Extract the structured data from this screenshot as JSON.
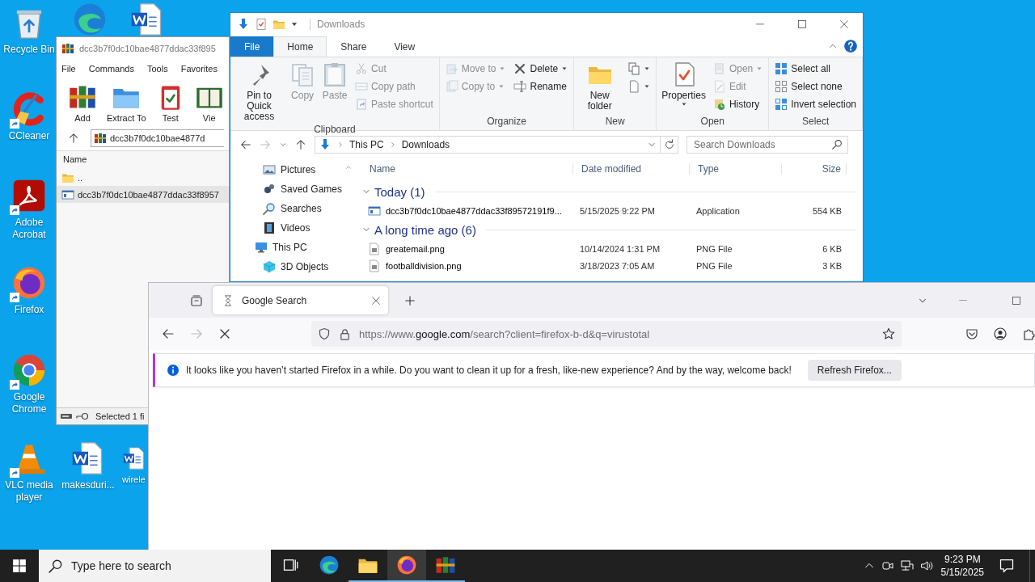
{
  "desktop_icons": [
    {
      "kind": "recycle",
      "label": "Recycle Bin",
      "shortcut": false
    },
    {
      "kind": "edge",
      "shortcut": false
    },
    {
      "kind": "word",
      "shortcut": false
    },
    {
      "kind": "ccleaner",
      "label": "CCleaner",
      "shortcut": true
    },
    {
      "kind": "acrobat",
      "label": "Adobe Acrobat",
      "shortcut": true
    },
    {
      "kind": "firefox",
      "label": "Firefox",
      "shortcut": true
    },
    {
      "kind": "chrome",
      "label": "Google Chrome",
      "shortcut": true
    },
    {
      "kind": "vlc",
      "label": "VLC media player",
      "shortcut": true
    },
    {
      "kind": "word",
      "label": "makesduri...",
      "shortcut": false
    },
    {
      "kind": "word",
      "label": "wirele",
      "shortcut": false
    }
  ],
  "winrar": {
    "title": "dcc3b7f0dc10bae4877ddac33f895",
    "menu": [
      "File",
      "Commands",
      "Tools",
      "Favorites"
    ],
    "toolbar": [
      {
        "kind": "winrar",
        "label": "Add"
      },
      {
        "kind": "extract",
        "label": "Extract To"
      },
      {
        "kind": "test",
        "label": "Test"
      },
      {
        "kind": "view",
        "label": "Vie"
      }
    ],
    "path": "dcc3b7f0dc10bae4877d",
    "column": "Name",
    "rows": [
      {
        "kind": "folder",
        "name": "..",
        "selected": false
      },
      {
        "kind": "exe",
        "name": "dcc3b7f0dc10bae4877ddac33f8957",
        "selected": true
      }
    ],
    "status": "Selected 1 fi"
  },
  "explorer": {
    "title": "Downloads",
    "tabs": [
      {
        "label": "File",
        "kind": "file",
        "selected": false
      },
      {
        "label": "Home",
        "kind": "tab",
        "selected": true
      },
      {
        "label": "Share",
        "kind": "tab",
        "selected": false
      },
      {
        "label": "View",
        "kind": "tab",
        "selected": false
      }
    ],
    "ribbon": [
      {
        "label": "Clipboard",
        "columns": [
          [
            {
              "kind": "pin",
              "label": "Pin to Quick access",
              "disabled": false
            }
          ],
          [
            {
              "kind": "copy",
              "label": "Copy",
              "disabled": true
            }
          ],
          [
            {
              "kind": "paste",
              "label": "Paste",
              "disabled": true
            }
          ],
          [
            {
              "kind": "cut",
              "label": "Cut",
              "disabled": true
            },
            {
              "kind": "copypath",
              "label": "Copy path",
              "disabled": true
            },
            {
              "kind": "pasteshortcut",
              "label": "Paste shortcut",
              "disabled": true
            }
          ]
        ]
      },
      {
        "label": "Organize",
        "columns": [
          [
            {
              "kind": "moveto",
              "label": "Move to",
              "disabled": true,
              "dropdown": true
            },
            {
              "kind": "copyto",
              "label": "Copy to",
              "disabled": true,
              "dropdown": true
            }
          ],
          [
            {
              "kind": "delete",
              "label": "Delete",
              "disabled": false,
              "dropdown": true
            },
            {
              "kind": "rename",
              "label": "Rename",
              "disabled": false
            }
          ]
        ]
      },
      {
        "label": "New",
        "columns": [
          [
            {
              "kind": "newfolder",
              "label": "New folder",
              "disabled": false
            }
          ],
          [
            {
              "kind": "newitem",
              "disabled": false,
              "dropdown": true
            },
            {
              "kind": "easy",
              "disabled": false,
              "dropdown": true
            }
          ]
        ]
      },
      {
        "label": "Open",
        "columns": [
          [
            {
              "kind": "properties",
              "label": "Properties",
              "disabled": false,
              "dropdown": true
            }
          ],
          [
            {
              "kind": "open",
              "label": "Open",
              "disabled": true,
              "dropdown": true
            },
            {
              "kind": "edit",
              "label": "Edit",
              "disabled": true
            },
            {
              "kind": "history",
              "label": "History",
              "disabled": false
            }
          ]
        ]
      },
      {
        "label": "Select",
        "columns": [
          [
            {
              "kind": "selectall",
              "label": "Select all",
              "disabled": false
            },
            {
              "kind": "selectnone",
              "label": "Select none",
              "disabled": false
            },
            {
              "kind": "invert",
              "label": "Invert selection",
              "disabled": false
            }
          ]
        ]
      }
    ],
    "breadcrumb": [
      "This PC",
      "Downloads"
    ],
    "search": {
      "placeholder": "Search Downloads"
    },
    "nav": [
      {
        "children": [
          {
            "kind": "pictures",
            "label": "Pictures"
          },
          {
            "kind": "games",
            "label": "Saved Games"
          },
          {
            "kind": "searches",
            "label": "Searches"
          },
          {
            "kind": "videos",
            "label": "Videos"
          }
        ]
      },
      {
        "kind": "pc",
        "label": "This PC",
        "children": [
          {
            "kind": "cube",
            "label": "3D Objects"
          }
        ]
      }
    ],
    "columns": [
      "Name",
      "Date modified",
      "Type",
      "Size"
    ],
    "groups": [
      {
        "title": "Today (1)",
        "expanded": true,
        "rows": [
          {
            "kind": "exe",
            "name": "dcc3b7f0dc10bae4877ddac33f89572191f9...",
            "date": "5/15/2025 9:22 PM",
            "type": "Application",
            "size": "554 KB"
          }
        ]
      },
      {
        "title": "A long time ago (6)",
        "expanded": true,
        "rows": [
          {
            "kind": "png",
            "name": "greatemail.png",
            "date": "10/14/2024 1:31 PM",
            "type": "PNG File",
            "size": "6 KB"
          },
          {
            "kind": "png",
            "name": "footballdivision.png",
            "date": "3/18/2023 7:05 AM",
            "type": "PNG File",
            "size": "3 KB"
          }
        ]
      }
    ]
  },
  "firefox": {
    "tabs": [
      {
        "title": "Google Search",
        "selected": true
      }
    ],
    "url": {
      "prefix": "https://www.",
      "domain": "google.com",
      "rest": "/search?client=firefox-b-d&q=virustotal"
    },
    "notification": {
      "text": "It looks like you haven’t started Firefox in a while. Do you want to clean it up for a fresh, like-new experience? And by the way, welcome back!",
      "button": "Refresh Firefox..."
    }
  },
  "taskbar": {
    "search": {
      "placeholder": "Type here to search"
    },
    "apps": [
      {
        "kind": "taskview",
        "open": false,
        "selected": false
      },
      {
        "kind": "edge",
        "open": false,
        "selected": false
      },
      {
        "kind": "folder",
        "open": true,
        "selected": false
      },
      {
        "kind": "firefox",
        "open": true,
        "selected": true
      },
      {
        "kind": "winrar",
        "open": true,
        "selected": false
      }
    ],
    "time": "9:23 PM",
    "date": "5/15/2025"
  }
}
